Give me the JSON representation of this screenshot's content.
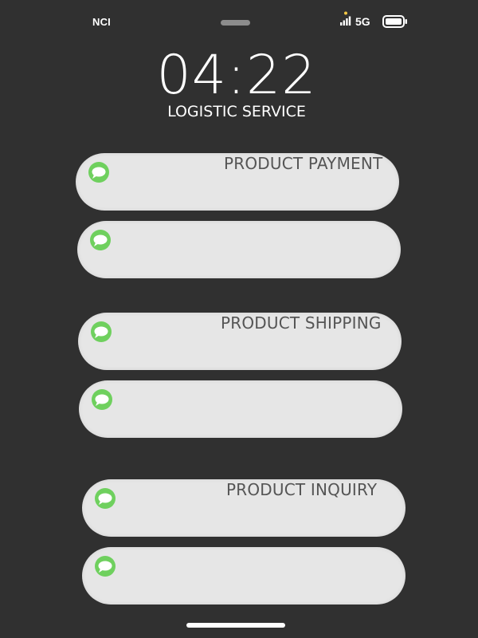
{
  "status_bar": {
    "carrier": "NCI",
    "network": "5G",
    "icons": [
      "signal-icon",
      "battery-icon"
    ]
  },
  "lock_screen": {
    "time": "04:22",
    "subtitle": "LOGISTIC SERVICE"
  },
  "notifications": [
    {
      "label": "PRODUCT PAYMENT",
      "icon": "chat-bubble-icon"
    },
    {
      "label": "",
      "icon": "chat-bubble-icon"
    },
    {
      "label": "PRODUCT SHIPPING",
      "icon": "chat-bubble-icon"
    },
    {
      "label": "",
      "icon": "chat-bubble-icon"
    },
    {
      "label": "PRODUCT INQUIRY",
      "icon": "chat-bubble-icon"
    },
    {
      "label": "",
      "icon": "chat-bubble-icon"
    }
  ],
  "colors": {
    "background": "#303030",
    "bubble": "#e6e6e6",
    "icon_green": "#6fd05e",
    "label_text": "#555555"
  }
}
